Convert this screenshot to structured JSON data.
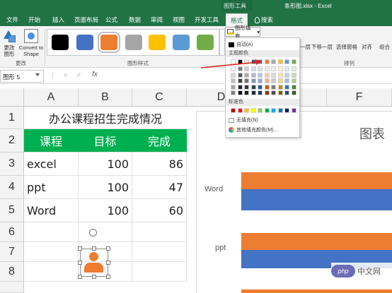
{
  "window": {
    "context_label": "图形工具",
    "title": "条形图.xlsx - Excel"
  },
  "tabs": [
    "文件",
    "开始",
    "插入",
    "页面布局",
    "公式",
    "数据",
    "审阅",
    "视图",
    "开发工具",
    "格式"
  ],
  "active_tab": "格式",
  "search_label": "搜索",
  "ribbon": {
    "change_shape_label": "更改图形",
    "convert_label": "Convert to Shape",
    "group_change": "更改",
    "group_styles": "图形样式",
    "group_arrange": "排列",
    "fill_label": "图形填充",
    "style_swatches": [
      "#000000",
      "#4472c4",
      "#ed7d31",
      "#a5a5a5",
      "#ffc000",
      "#5b9bd5",
      "#70ad47"
    ],
    "selected_swatch": 2,
    "right_buttons": [
      "一层",
      "下移一层",
      "选择窗格",
      "对齐",
      "组合"
    ]
  },
  "formula_bar": {
    "name_box": "图形 5",
    "cancel_icon": "×",
    "enter_icon": "✓",
    "fx": "fx"
  },
  "columns": [
    "A",
    "B",
    "C",
    "D",
    "E",
    "F"
  ],
  "rows": [
    "1",
    "2",
    "3",
    "4",
    "5",
    "6",
    "7",
    "8"
  ],
  "table": {
    "title": "办公课程招生完成情况",
    "headers": [
      "课程",
      "目标",
      "完成"
    ],
    "rows": [
      [
        "excel",
        "100",
        "86"
      ],
      [
        "ppt",
        "100",
        "47"
      ],
      [
        "Word",
        "100",
        "60"
      ]
    ],
    "header_color": "#00b050"
  },
  "chart_data": {
    "type": "bar",
    "title": "图表",
    "categories": [
      "Word",
      "ppt"
    ],
    "series_colors": [
      "#ed7d31",
      "#4472c4"
    ]
  },
  "dropdown": {
    "auto": "自动(A)",
    "theme_colors": "主题颜色",
    "standard_colors": "标准色",
    "no_fill": "无填充(N)",
    "more_colors": "其他填充颜色(M)...",
    "theme_top": [
      "#ffffff",
      "#000000",
      "#e7e6e6",
      "#44546a",
      "#4472c4",
      "#ed7d31",
      "#a5a5a5",
      "#ffc000",
      "#5b9bd5",
      "#70ad47"
    ],
    "theme_shades": [
      [
        "#f2f2f2",
        "#7f7f7f",
        "#d0cece",
        "#d6dce4",
        "#d9e2f3",
        "#fbe5d6",
        "#ededed",
        "#fff2cc",
        "#ddebf7",
        "#e2efda"
      ],
      [
        "#d9d9d9",
        "#595959",
        "#aeabab",
        "#adb9ca",
        "#b4c6e7",
        "#f8cbad",
        "#dbdbdb",
        "#ffe699",
        "#bdd7ee",
        "#c6e0b4"
      ],
      [
        "#bfbfbf",
        "#404040",
        "#757171",
        "#8497b0",
        "#8eaadb",
        "#f4b084",
        "#c9c9c9",
        "#ffd966",
        "#9bc2e6",
        "#a9d08e"
      ],
      [
        "#a6a6a6",
        "#262626",
        "#3a3838",
        "#333f4f",
        "#2f5496",
        "#c65911",
        "#7b7b7b",
        "#bf8f00",
        "#2e75b6",
        "#548235"
      ],
      [
        "#808080",
        "#0d0d0d",
        "#171616",
        "#222a35",
        "#1f3864",
        "#833c0b",
        "#525252",
        "#7f6000",
        "#1f4e78",
        "#375623"
      ]
    ],
    "standard": [
      "#c00000",
      "#ff0000",
      "#ffc000",
      "#ffff00",
      "#92d050",
      "#00b050",
      "#00b0f0",
      "#0070c0",
      "#002060",
      "#7030a0"
    ]
  },
  "watermark": {
    "logo": "php",
    "text": "中文网"
  }
}
